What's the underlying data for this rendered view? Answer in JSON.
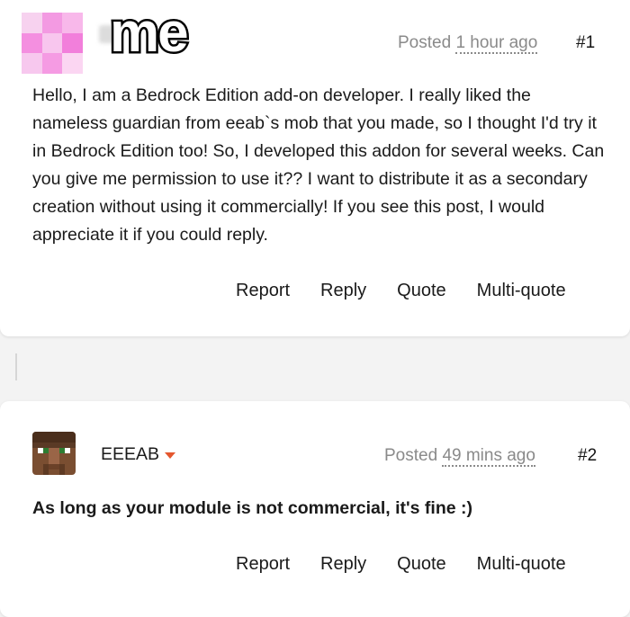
{
  "posts": [
    {
      "author_label": "me",
      "posted_prefix": "Posted",
      "posted_time": "1 hour ago",
      "number": "#1",
      "body": "Hello, I am a Bedrock Edition add-on developer. I really liked the nameless guardian from eeab`s mob that you made, so I thought I'd try it in Bedrock Edition too! So, I developed this addon for several weeks. Can you give me permission to use it?? I want to distribute it as a secondary creation without using it commercially! If you see this post, I would appreciate it if you could reply.",
      "actions": [
        "Report",
        "Reply",
        "Quote",
        "Multi-quote"
      ],
      "avatar_colors": [
        "#f7d2ef",
        "#f39ae2",
        "#f8b8ea",
        "#f48fe0",
        "#f8c6ee",
        "#f27fdb",
        "#f7c8ee",
        "#f59be3",
        "#fbd6f2"
      ]
    },
    {
      "author": "EEEAB",
      "posted_prefix": "Posted",
      "posted_time": "49 mins ago",
      "number": "#2",
      "body": "As long as your module is not commercial, it's fine :)",
      "actions": [
        "Report",
        "Reply",
        "Quote",
        "Multi-quote"
      ],
      "avatar_icon": "villager-face-icon"
    }
  ],
  "colors": {
    "accent_caret": "#e4572e",
    "muted_text": "#8a8a8a"
  }
}
